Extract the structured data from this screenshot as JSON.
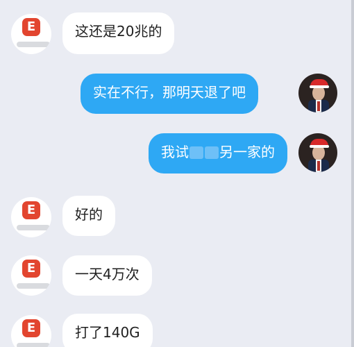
{
  "chat": {
    "messages": [
      {
        "side": "incoming",
        "text": "这还是20兆的",
        "avatar_icon": "company-logo-icon"
      },
      {
        "side": "outgoing",
        "text": "实在不行，那明天退了吧",
        "avatar_icon": "user-avatar-icon"
      },
      {
        "side": "outgoing",
        "text_before": "我试",
        "text_after": "另一家的",
        "has_redaction": true,
        "avatar_icon": "user-avatar-icon"
      },
      {
        "side": "incoming",
        "text": "好的",
        "avatar_icon": "company-logo-icon"
      },
      {
        "side": "incoming",
        "text": "一天4万次",
        "avatar_icon": "company-logo-icon"
      },
      {
        "side": "incoming",
        "text": "打了140G",
        "avatar_icon": "company-logo-icon"
      }
    ]
  },
  "logo": {
    "letter": "E",
    "color": "#e2452f"
  },
  "colors": {
    "background": "#eaecf3",
    "outgoing_bubble": "#2ea8f4",
    "incoming_bubble": "#ffffff"
  }
}
